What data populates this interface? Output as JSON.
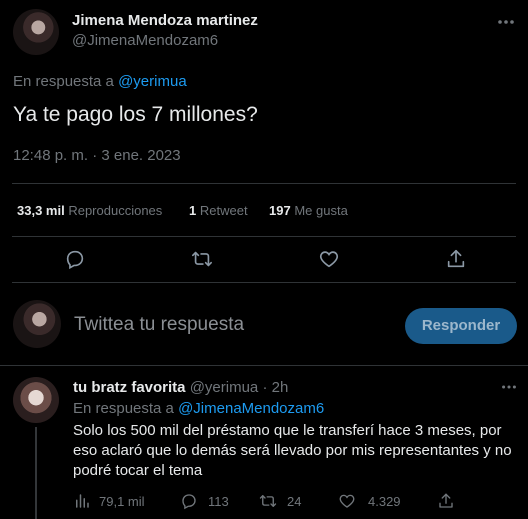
{
  "tweet": {
    "author_name": "Jimena Mendoza martinez",
    "author_handle": "@JimenaMendozam6",
    "reply_to_prefix": "En respuesta a ",
    "reply_to_handle": "@yerimua",
    "text": "Ya te pago los 7 millones?",
    "timestamp": "12:48 p. m. · 3 ene. 2023",
    "stats": {
      "views_count": "33,3 mil",
      "views_label": "Reproducciones",
      "retweets_count": "1",
      "retweets_label": "Retweet",
      "likes_count": "197",
      "likes_label": "Me gusta"
    }
  },
  "actions": [
    "reply-icon",
    "retweet-icon",
    "like-icon",
    "share-icon"
  ],
  "compose": {
    "placeholder": "Twittea tu respuesta",
    "button_label": "Responder"
  },
  "reply": {
    "author_name": "tu bratz favorita",
    "author_handle": "@yerimua",
    "time": "· 2h",
    "reply_to_prefix": "En respuesta a ",
    "reply_to_handle": "@JimenaMendozam6",
    "text": "Solo los 500 mil del préstamo que le transferí hace 3 meses, por eso aclaró que lo demás será llevado por mis representantes y no podré tocar el tema",
    "views": "79,1 mil",
    "replies": "113",
    "retweets": "24",
    "likes": "4.329"
  },
  "colors": {
    "background": "#000000",
    "text": "#e7e9ea",
    "muted": "#71767b",
    "accent": "#1d9bf0",
    "divider": "#2f3336"
  }
}
